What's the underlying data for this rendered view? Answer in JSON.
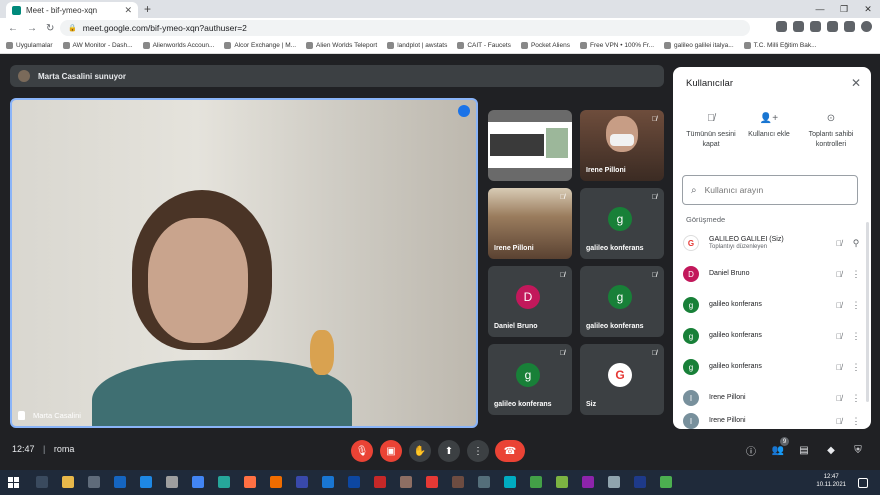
{
  "browser": {
    "tab_title": "Meet - bif-ymeo-xqn",
    "tab_close": "✕",
    "new_tab": "+",
    "url": "meet.google.com/bif-ymeo-xqn?authuser=2",
    "nav_back": "←",
    "nav_forward": "→",
    "nav_reload": "↻",
    "window_controls": [
      "—",
      "❐",
      "✕"
    ],
    "bookmarks": [
      "Uygulamalar",
      "AW Monitor - Dash...",
      "Alienworlds Accoun...",
      "Alcor Exchange | M...",
      "Alien Worlds Teleport",
      "landplot | awstats",
      "CAIT - Faucets",
      "Pocket Aliens",
      "Free VPN • 100% Fr...",
      "galileo galilei italya...",
      "T.C. Milli Eğitim Bak..."
    ]
  },
  "meet": {
    "presenter_text": "Marta Casalini sunuyor",
    "main_video_name": "Marta Casalini",
    "tiles": [
      {
        "label": "",
        "kind": "screen"
      },
      {
        "label": "Irene Pilloni",
        "kind": "irene"
      },
      {
        "label": "Irene Pilloni",
        "kind": "room"
      },
      {
        "label": "galileo konferans",
        "initial": "g",
        "color": "#188038"
      },
      {
        "label": "Daniel Bruno",
        "initial": "D",
        "color": "#c2185b"
      },
      {
        "label": "galileo konferans",
        "initial": "g",
        "color": "#188038"
      },
      {
        "label": "galileo konferans",
        "initial": "g",
        "color": "#188038"
      },
      {
        "label": "Siz",
        "kind": "logo"
      }
    ],
    "time": "12:47",
    "meeting_code": "roma",
    "participant_count": "9",
    "colors": {
      "end_call": "#ea4335",
      "mic_off": "#ea4335",
      "active_speaker": "#8ab4f8"
    }
  },
  "panel": {
    "title": "Kullanıcılar",
    "actions": [
      "Tümünün sesini kapat",
      "Kullanıcı ekle",
      "Toplantı sahibi kontrolleri"
    ],
    "search_placeholder": "Kullanıcı arayın",
    "section": "Görüşmede",
    "participants": [
      {
        "name": "GALILEO GALILEI (Siz)",
        "sub": "Toplantıyı düzenleyen",
        "initial": "G",
        "color": "#ffffff"
      },
      {
        "name": "Daniel Bruno",
        "initial": "D",
        "color": "#c2185b"
      },
      {
        "name": "galileo konferans",
        "initial": "g",
        "color": "#188038"
      },
      {
        "name": "galileo konferans",
        "initial": "g",
        "color": "#188038"
      },
      {
        "name": "galileo konferans",
        "initial": "g",
        "color": "#188038"
      },
      {
        "name": "Irene Pilloni",
        "initial": "I",
        "color": "#78909c"
      },
      {
        "name": "Irene Pilloni",
        "initial": "I",
        "color": "#78909c"
      }
    ]
  },
  "taskbar": {
    "time": "12:47",
    "date": "10.11.2021"
  }
}
